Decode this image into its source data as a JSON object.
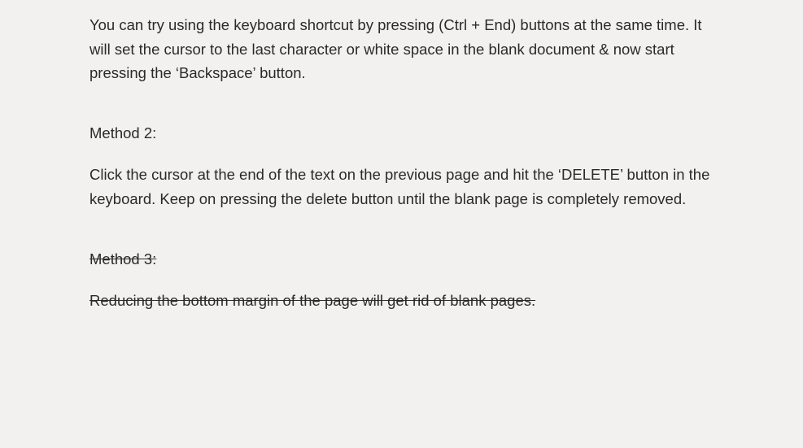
{
  "method1": {
    "body": "You can try using the keyboard shortcut by pressing (Ctrl + End) buttons at the same time. It will set the cursor to the last character or white space in the blank document & now start pressing the ‘Backspace’ button."
  },
  "method2": {
    "heading": "Method 2:",
    "body": "Click the cursor at the end of the text on the previous page and hit the ‘DELETE’ button in the keyboard. Keep on pressing the delete button until the blank page is completely removed."
  },
  "method3": {
    "heading": "Method 3:",
    "body": "Reducing the bottom margin of the page will get rid of blank pages."
  }
}
